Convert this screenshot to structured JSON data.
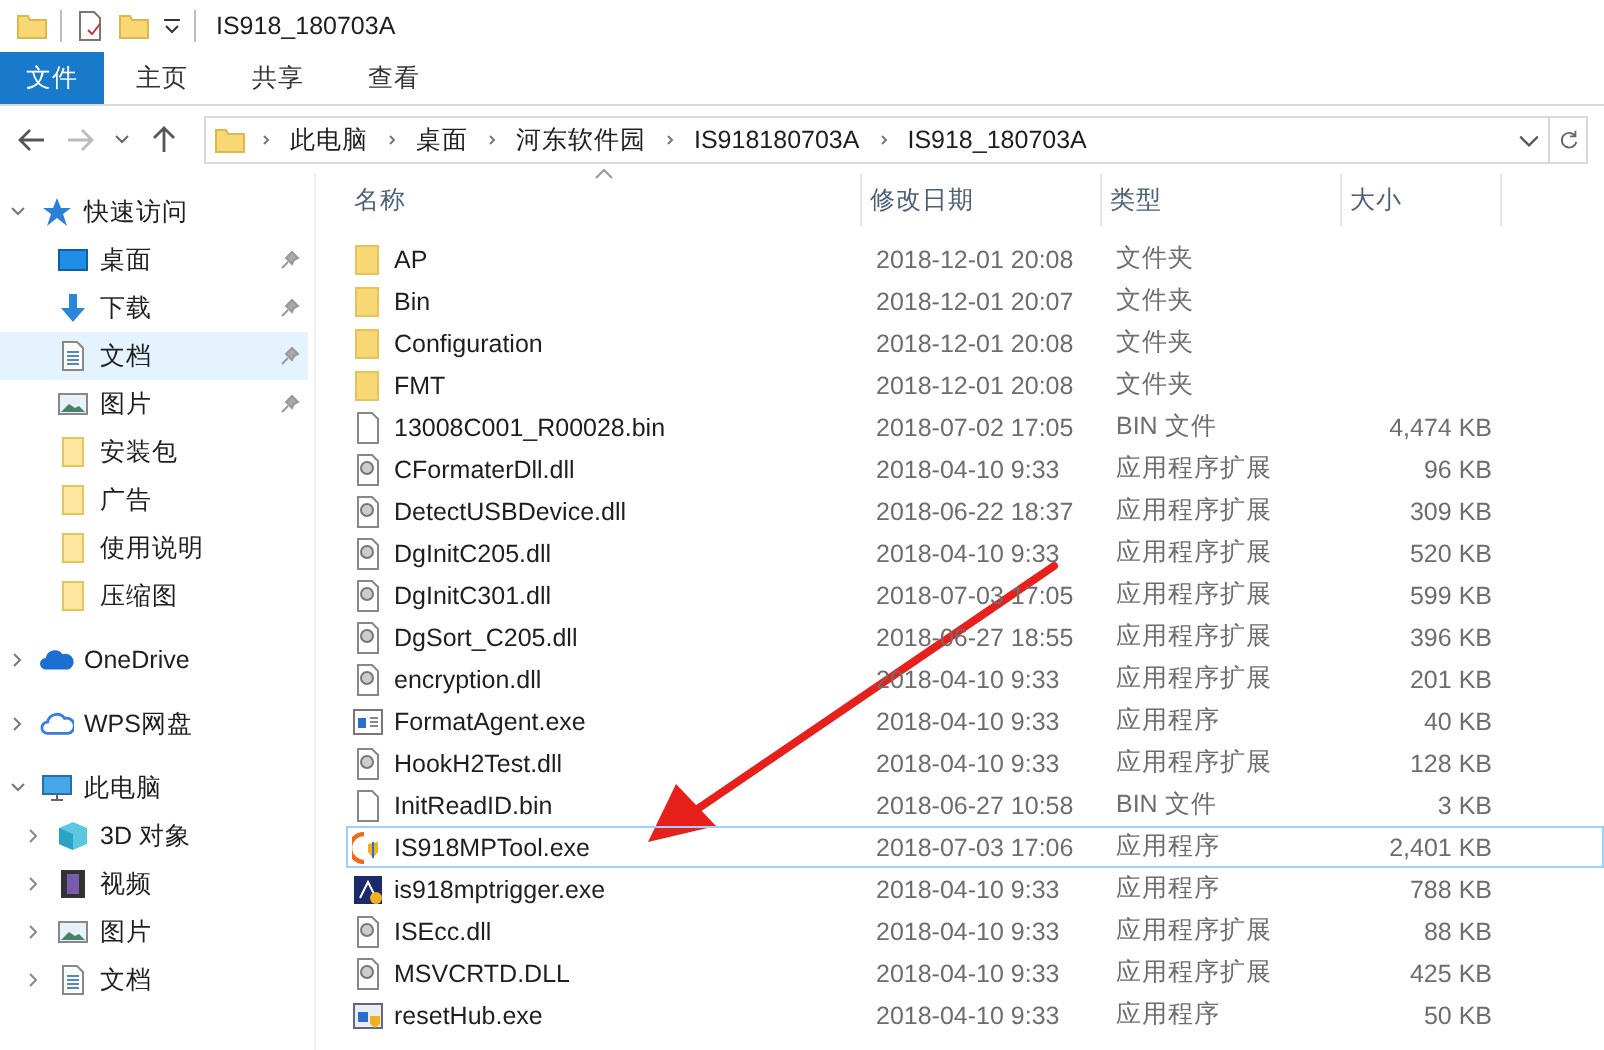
{
  "window": {
    "title": "IS918_180703A"
  },
  "ribbon_tabs": [
    {
      "label": "文件",
      "kind": "file_menu"
    },
    {
      "label": "主页",
      "kind": "tab"
    },
    {
      "label": "共享",
      "kind": "tab"
    },
    {
      "label": "查看",
      "kind": "tab"
    }
  ],
  "nav": {
    "back_disabled": false,
    "forward_disabled": true
  },
  "address": {
    "path": [
      "此电脑",
      "桌面",
      "河东软件园",
      "IS918180703A",
      "IS918_180703A"
    ]
  },
  "sidebar": {
    "items": [
      {
        "label": "快速访问",
        "kind": "star",
        "expanded": true,
        "children": [
          {
            "label": "桌面",
            "kind": "desktop",
            "pinned": true,
            "selected": false
          },
          {
            "label": "下载",
            "kind": "download",
            "pinned": true,
            "selected": false
          },
          {
            "label": "文档",
            "kind": "document",
            "pinned": true,
            "selected": true
          },
          {
            "label": "图片",
            "kind": "pictures",
            "pinned": true,
            "selected": false
          },
          {
            "label": "安装包",
            "kind": "folder",
            "pinned": false,
            "selected": false
          },
          {
            "label": "广告",
            "kind": "folder",
            "pinned": false,
            "selected": false
          },
          {
            "label": "使用说明",
            "kind": "folder",
            "pinned": false,
            "selected": false
          },
          {
            "label": "压缩图",
            "kind": "folder",
            "pinned": false,
            "selected": false
          }
        ]
      },
      {
        "label": "OneDrive",
        "kind": "cloud",
        "expanded": false
      },
      {
        "label": "WPS网盘",
        "kind": "cloud_outline",
        "expanded": false
      },
      {
        "label": "此电脑",
        "kind": "pc",
        "expanded": true,
        "children": [
          {
            "label": "3D 对象",
            "kind": "cube",
            "expanded": false,
            "selected": false
          },
          {
            "label": "视频",
            "kind": "video",
            "expanded": false,
            "selected": false
          },
          {
            "label": "图片",
            "kind": "pictures",
            "expanded": false,
            "selected": false
          },
          {
            "label": "文档",
            "kind": "document",
            "expanded": false,
            "selected": false
          }
        ]
      }
    ]
  },
  "table": {
    "columns": [
      {
        "label": "名称",
        "sorted": true
      },
      {
        "label": "修改日期",
        "sorted": false
      },
      {
        "label": "类型",
        "sorted": false
      },
      {
        "label": "大小",
        "sorted": false
      }
    ],
    "rows": [
      {
        "name": "AP",
        "date": "2018-12-01 20:08",
        "type": "文件夹",
        "size": "",
        "kind": "folder",
        "selected": false
      },
      {
        "name": "Bin",
        "date": "2018-12-01 20:07",
        "type": "文件夹",
        "size": "",
        "kind": "folder",
        "selected": false
      },
      {
        "name": "Configuration",
        "date": "2018-12-01 20:08",
        "type": "文件夹",
        "size": "",
        "kind": "folder",
        "selected": false
      },
      {
        "name": "FMT",
        "date": "2018-12-01 20:08",
        "type": "文件夹",
        "size": "",
        "kind": "folder",
        "selected": false
      },
      {
        "name": "13008C001_R00028.bin",
        "date": "2018-07-02 17:05",
        "type": "BIN 文件",
        "size": "4,474 KB",
        "kind": "file",
        "selected": false
      },
      {
        "name": "CFormaterDll.dll",
        "date": "2018-04-10 9:33",
        "type": "应用程序扩展",
        "size": "96 KB",
        "kind": "dll",
        "selected": false
      },
      {
        "name": "DetectUSBDevice.dll",
        "date": "2018-06-22 18:37",
        "type": "应用程序扩展",
        "size": "309 KB",
        "kind": "dll",
        "selected": false
      },
      {
        "name": "DgInitC205.dll",
        "date": "2018-04-10 9:33",
        "type": "应用程序扩展",
        "size": "520 KB",
        "kind": "dll",
        "selected": false
      },
      {
        "name": "DgInitC301.dll",
        "date": "2018-07-03 17:05",
        "type": "应用程序扩展",
        "size": "599 KB",
        "kind": "dll",
        "selected": false
      },
      {
        "name": "DgSort_C205.dll",
        "date": "2018-06-27 18:55",
        "type": "应用程序扩展",
        "size": "396 KB",
        "kind": "dll",
        "selected": false
      },
      {
        "name": "encryption.dll",
        "date": "2018-04-10 9:33",
        "type": "应用程序扩展",
        "size": "201 KB",
        "kind": "dll",
        "selected": false
      },
      {
        "name": "FormatAgent.exe",
        "date": "2018-04-10 9:33",
        "type": "应用程序",
        "size": "40 KB",
        "kind": "window_app",
        "selected": false
      },
      {
        "name": "HookH2Test.dll",
        "date": "2018-04-10 9:33",
        "type": "应用程序扩展",
        "size": "128 KB",
        "kind": "dll",
        "selected": false
      },
      {
        "name": "InitReadID.bin",
        "date": "2018-06-27 10:58",
        "type": "BIN 文件",
        "size": "3 KB",
        "kind": "file",
        "selected": false
      },
      {
        "name": "IS918MPTool.exe",
        "date": "2018-07-03 17:06",
        "type": "应用程序",
        "size": "2,401 KB",
        "kind": "orange_app",
        "selected": true
      },
      {
        "name": "is918mptrigger.exe",
        "date": "2018-04-10 9:33",
        "type": "应用程序",
        "size": "788 KB",
        "kind": "dark_app",
        "selected": false
      },
      {
        "name": "ISEcc.dll",
        "date": "2018-04-10 9:33",
        "type": "应用程序扩展",
        "size": "88 KB",
        "kind": "dll",
        "selected": false
      },
      {
        "name": "MSVCRTD.DLL",
        "date": "2018-04-10 9:33",
        "type": "应用程序扩展",
        "size": "425 KB",
        "kind": "dll",
        "selected": false
      },
      {
        "name": "resetHub.exe",
        "date": "2018-04-10 9:33",
        "type": "应用程序",
        "size": "50 KB",
        "kind": "shield_app",
        "selected": false
      }
    ]
  }
}
